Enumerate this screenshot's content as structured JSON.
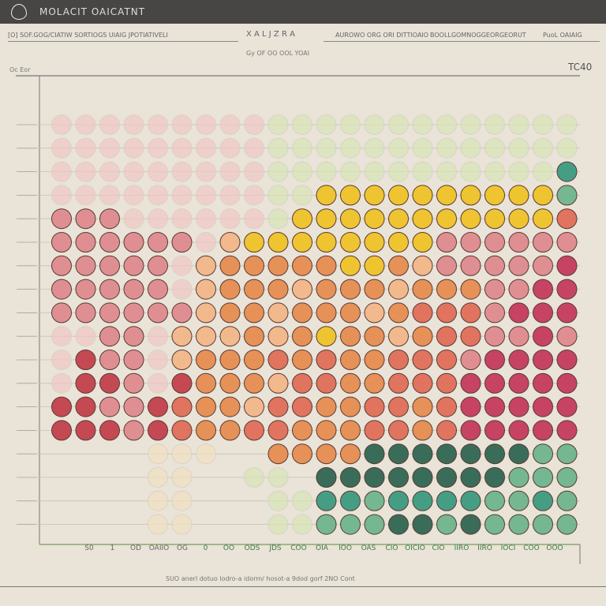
{
  "window": {
    "title": "MOLACIT OAICATNT"
  },
  "header": {
    "left_text": "[O] SOF.GOG/CIATIW SORTIOGS UIAIG JPOTIATIVELI",
    "center_text": "X A L  J Z R A",
    "right_text_1": "AUROWO ORG ORI DITTIOAIO",
    "right_text_2": "BOOLLGOMNOGGEORGEORUT",
    "right_text_3": "PuoL OAIAIG"
  },
  "chart_data": {
    "type": "scatter",
    "title": "",
    "subtitle": "Gy OF  OO OOL YOAI",
    "ylabel": "Oc Eor",
    "corner_label": "TC40",
    "x_tick_labels": [
      "S0",
      "1",
      "OD",
      "OAIIO",
      "OG",
      "0",
      "OO",
      "ODS",
      "JDS",
      "COO",
      "OIA",
      "IOO",
      "OAS",
      "CIO",
      "OICIO",
      "CIO",
      "IIRO",
      "IIRO",
      "IOCI",
      "COO",
      "OOO"
    ],
    "footer_caption": "SUO anerl dotuo lodro-a idorm/ hosot-a  9dod gorf 2NO Cont",
    "color_key": {
      "p": "#f0c6c4",
      "P": "#de8a8e",
      "R": "#c2404c",
      "K": "#c43a5e",
      "S": "#df6e58",
      "O": "#e68c50",
      "A": "#f2b689",
      "Y": "#efc228",
      "L": "#d6e4b6",
      "C": "#efe0c2",
      "G": "#2f6652",
      "M": "#6fb48c",
      "T": "#3c9a80"
    },
    "rows": [
      "pppppppppLLLLLLLLLLLLL",
      "pppppppppLLLLLLLLLLLLL",
      "pppppppppLLLLLLLLLLLLT",
      "pppppppppLLYYYYYYYYYYM",
      "PPPppppppLYYYYYYYYYYYS",
      "PPPPPPpAYYYYYYYYPPPPPP",
      "PPPPPpAOOOOOYYOAPPPPPK",
      "PPPPPpAOOOAOOOAOOOPPKK",
      "PPPPPPAOOAOOOAOSSSPKKK",
      "ppPPpAAAOAOYOOAOSSPPKP",
      "pRPPpAOOOSOSOOSSSPKKKK",
      "pRRPpROOOASSOOSSSKKKKK",
      "RRPPRSOOASSOOSSOSKKKKK",
      "RRRPRSOOSSOOOSSOSKKKKK",
      "....CCC..OOOOGGGGGGGMM",
      "....CC..LL.GGGGGGGGMMM",
      "....CC...LLTTMTTTTMMTM",
      "....CC...LLMMMGGMGMMMM"
    ]
  }
}
